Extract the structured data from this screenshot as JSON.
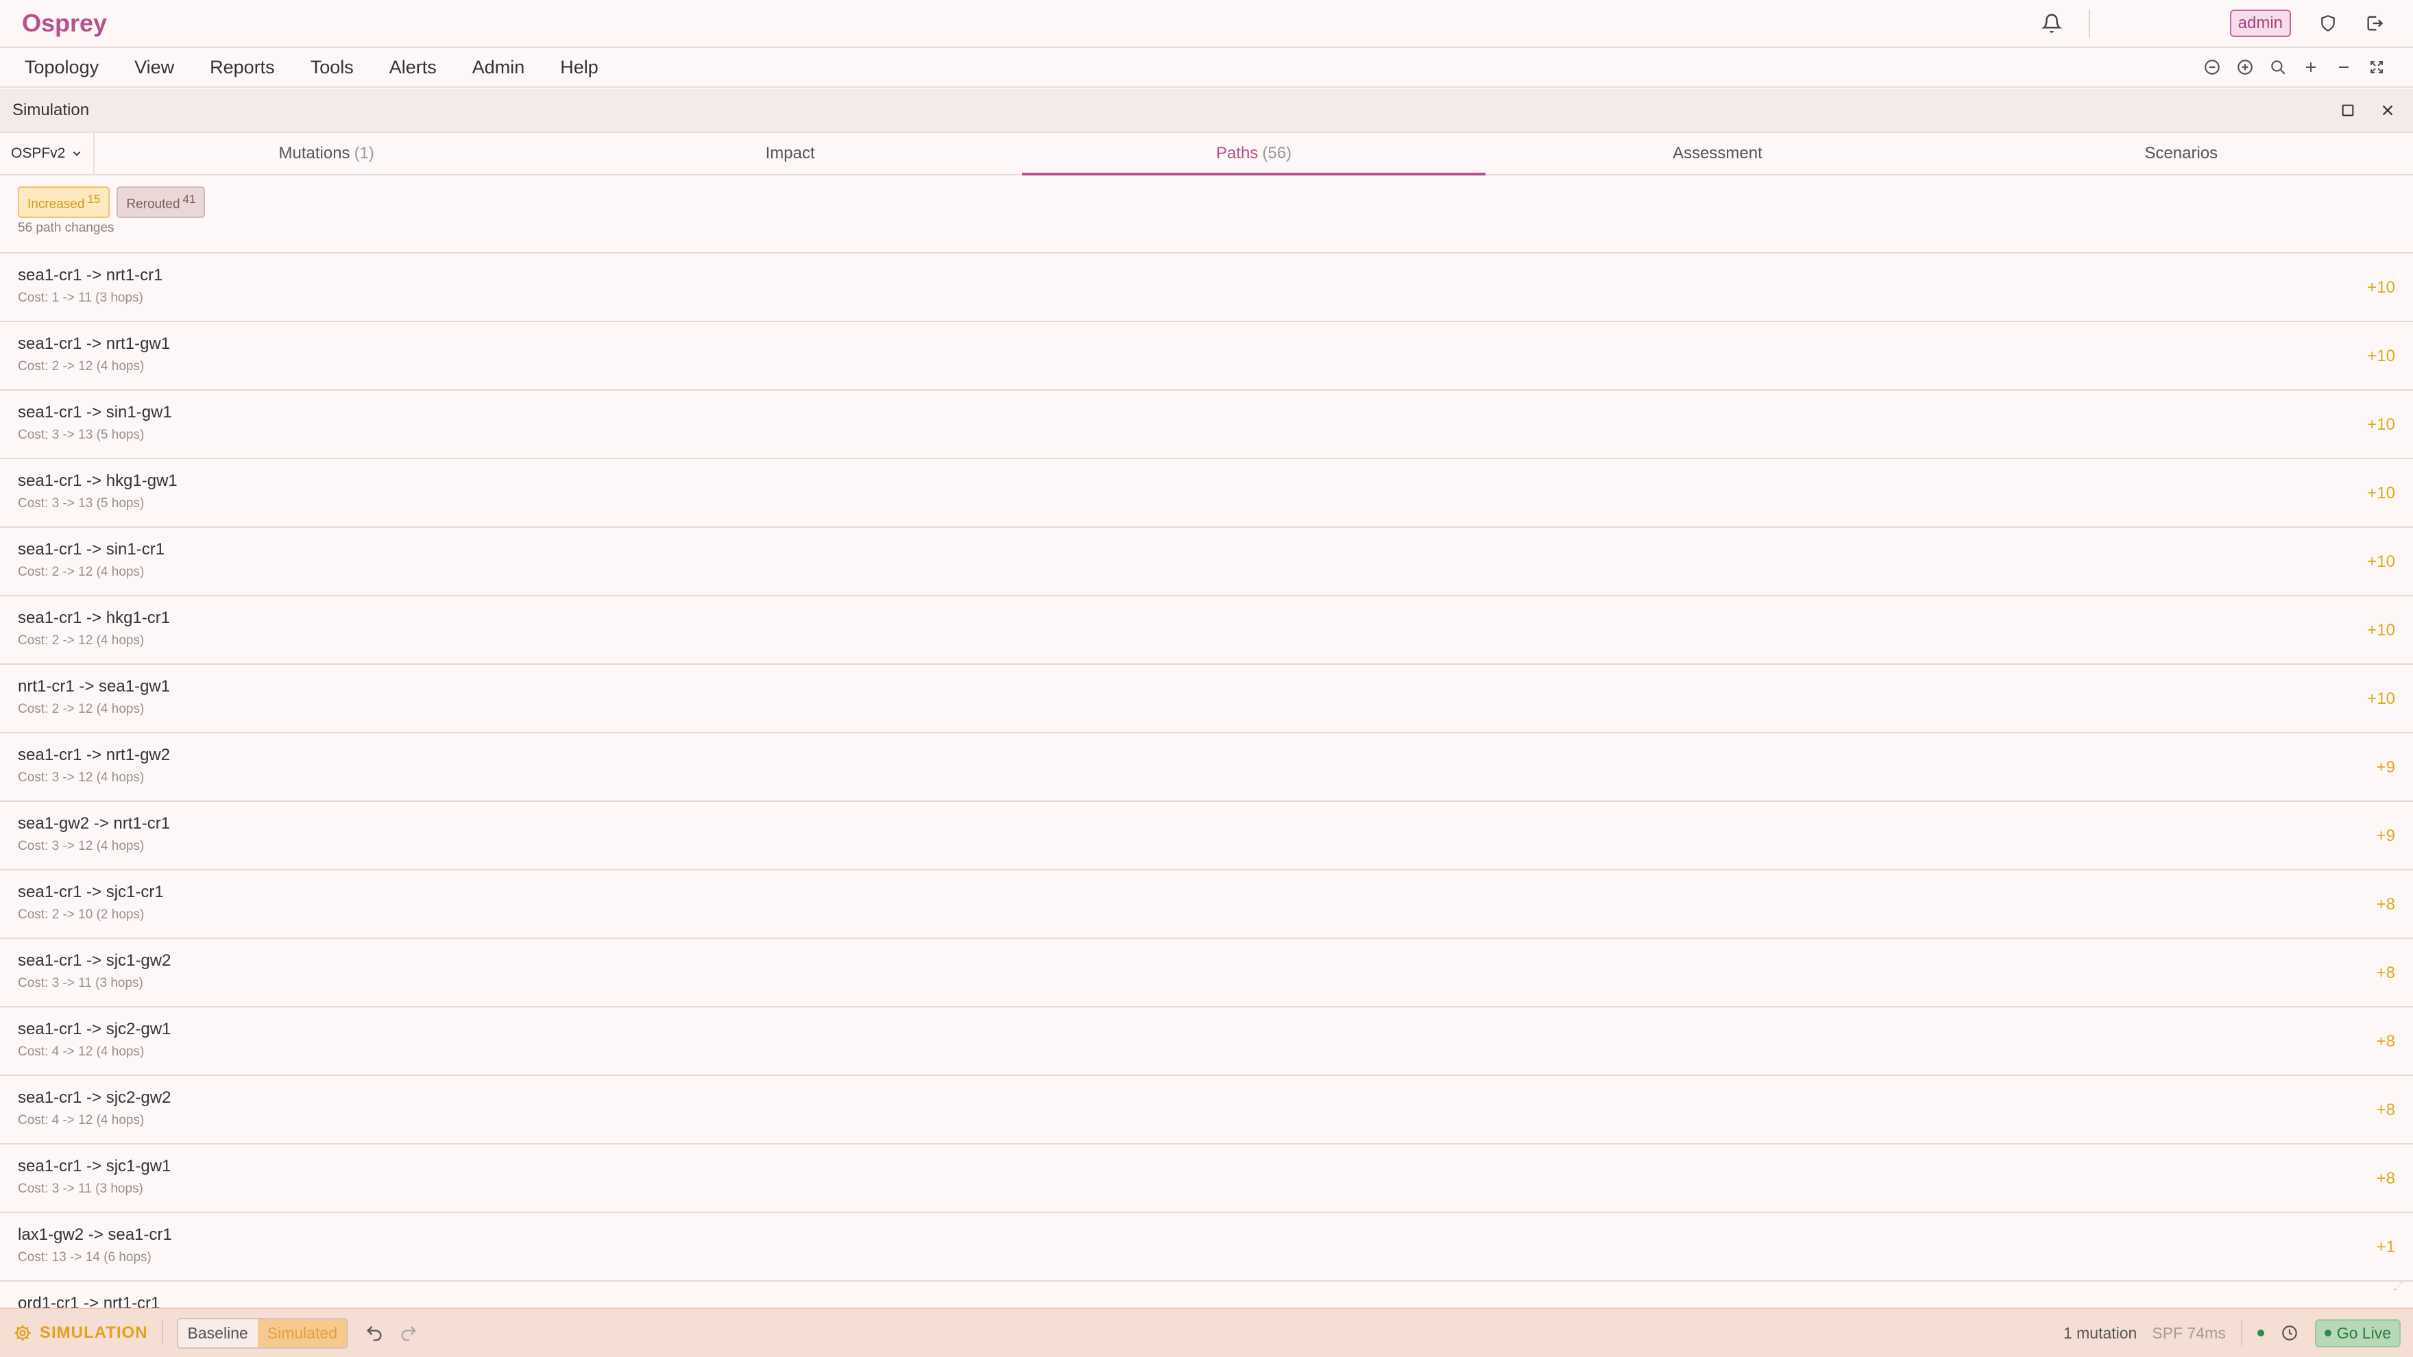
{
  "app": {
    "brand": "Osprey",
    "user_badge": "admin"
  },
  "menu": [
    "Topology",
    "View",
    "Reports",
    "Tools",
    "Alerts",
    "Admin",
    "Help"
  ],
  "panel": {
    "title": "Simulation",
    "protocol": "OSPFv2",
    "tabs": [
      {
        "label": "Mutations",
        "count": "(1)"
      },
      {
        "label": "Impact",
        "count": ""
      },
      {
        "label": "Paths",
        "count": "(56)"
      },
      {
        "label": "Assessment",
        "count": ""
      },
      {
        "label": "Scenarios",
        "count": ""
      }
    ],
    "active_tab": "Paths"
  },
  "filters": {
    "increased": {
      "label": "Increased",
      "count": "15"
    },
    "rerouted": {
      "label": "Rerouted",
      "count": "41"
    },
    "summary": "56 path changes"
  },
  "paths": [
    {
      "name": "sea1-cr1 -> nrt1-cr1",
      "cost": "Cost: 1 -> 11 (3 hops)",
      "delta": "+10"
    },
    {
      "name": "sea1-cr1 -> nrt1-gw1",
      "cost": "Cost: 2 -> 12 (4 hops)",
      "delta": "+10"
    },
    {
      "name": "sea1-cr1 -> sin1-gw1",
      "cost": "Cost: 3 -> 13 (5 hops)",
      "delta": "+10"
    },
    {
      "name": "sea1-cr1 -> hkg1-gw1",
      "cost": "Cost: 3 -> 13 (5 hops)",
      "delta": "+10"
    },
    {
      "name": "sea1-cr1 -> sin1-cr1",
      "cost": "Cost: 2 -> 12 (4 hops)",
      "delta": "+10"
    },
    {
      "name": "sea1-cr1 -> hkg1-cr1",
      "cost": "Cost: 2 -> 12 (4 hops)",
      "delta": "+10"
    },
    {
      "name": "nrt1-cr1 -> sea1-gw1",
      "cost": "Cost: 2 -> 12 (4 hops)",
      "delta": "+10"
    },
    {
      "name": "sea1-cr1 -> nrt1-gw2",
      "cost": "Cost: 3 -> 12 (4 hops)",
      "delta": "+9"
    },
    {
      "name": "sea1-gw2 -> nrt1-cr1",
      "cost": "Cost: 3 -> 12 (4 hops)",
      "delta": "+9"
    },
    {
      "name": "sea1-cr1 -> sjc1-cr1",
      "cost": "Cost: 2 -> 10 (2 hops)",
      "delta": "+8"
    },
    {
      "name": "sea1-cr1 -> sjc1-gw2",
      "cost": "Cost: 3 -> 11 (3 hops)",
      "delta": "+8"
    },
    {
      "name": "sea1-cr1 -> sjc2-gw1",
      "cost": "Cost: 4 -> 12 (4 hops)",
      "delta": "+8"
    },
    {
      "name": "sea1-cr1 -> sjc2-gw2",
      "cost": "Cost: 4 -> 12 (4 hops)",
      "delta": "+8"
    },
    {
      "name": "sea1-cr1 -> sjc1-gw1",
      "cost": "Cost: 3 -> 11 (3 hops)",
      "delta": "+8"
    },
    {
      "name": "lax1-gw2 -> sea1-cr1",
      "cost": "Cost: 13 -> 14 (6 hops)",
      "delta": "+1"
    },
    {
      "name": "ord1-cr1 -> nrt1-cr1",
      "cost": "",
      "delta": ""
    }
  ],
  "status": {
    "mode": "SIMULATION",
    "baseline": "Baseline",
    "simulated": "Simulated",
    "mutations": "1 mutation",
    "spf": "SPF 74ms",
    "go_live": "Go Live"
  },
  "colors": {
    "brand": "#b3528f",
    "delta": "#dcaa1c",
    "simulation": "#e0a31a",
    "live": "#2e8b4f"
  }
}
